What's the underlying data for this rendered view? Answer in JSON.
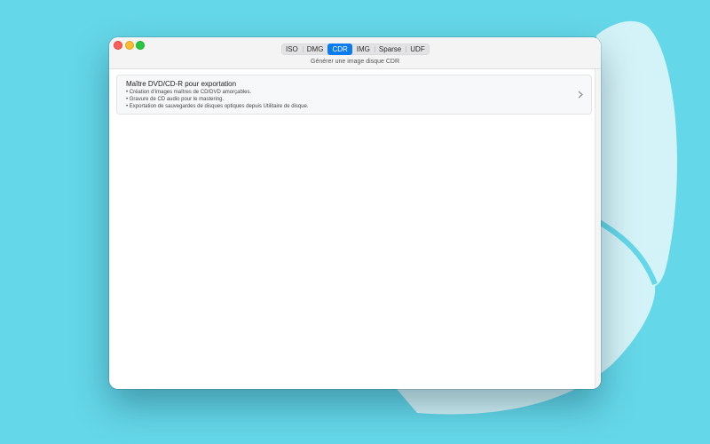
{
  "colors": {
    "background": "#64d7e8",
    "accent": "#0a7cf0"
  },
  "window": {
    "title": "Générer une image disque CDR",
    "tabs": [
      {
        "label": "ISO",
        "active": false
      },
      {
        "label": "DMG",
        "active": false
      },
      {
        "label": "CDR",
        "active": true
      },
      {
        "label": "IMG",
        "active": false
      },
      {
        "label": "Sparse",
        "active": false
      },
      {
        "label": "UDF",
        "active": false
      }
    ]
  },
  "options": [
    {
      "title": "Maître DVD/CD-R pour exportation",
      "bullets": [
        "• Création d’images maîtres de CD/DVD amorçables.",
        "• Gravure de CD audio pour le mastering.",
        "• Exportation de sauvegardes de disques optiques depuis Utilitaire de disque."
      ],
      "icon": "chevron-right-icon"
    }
  ]
}
